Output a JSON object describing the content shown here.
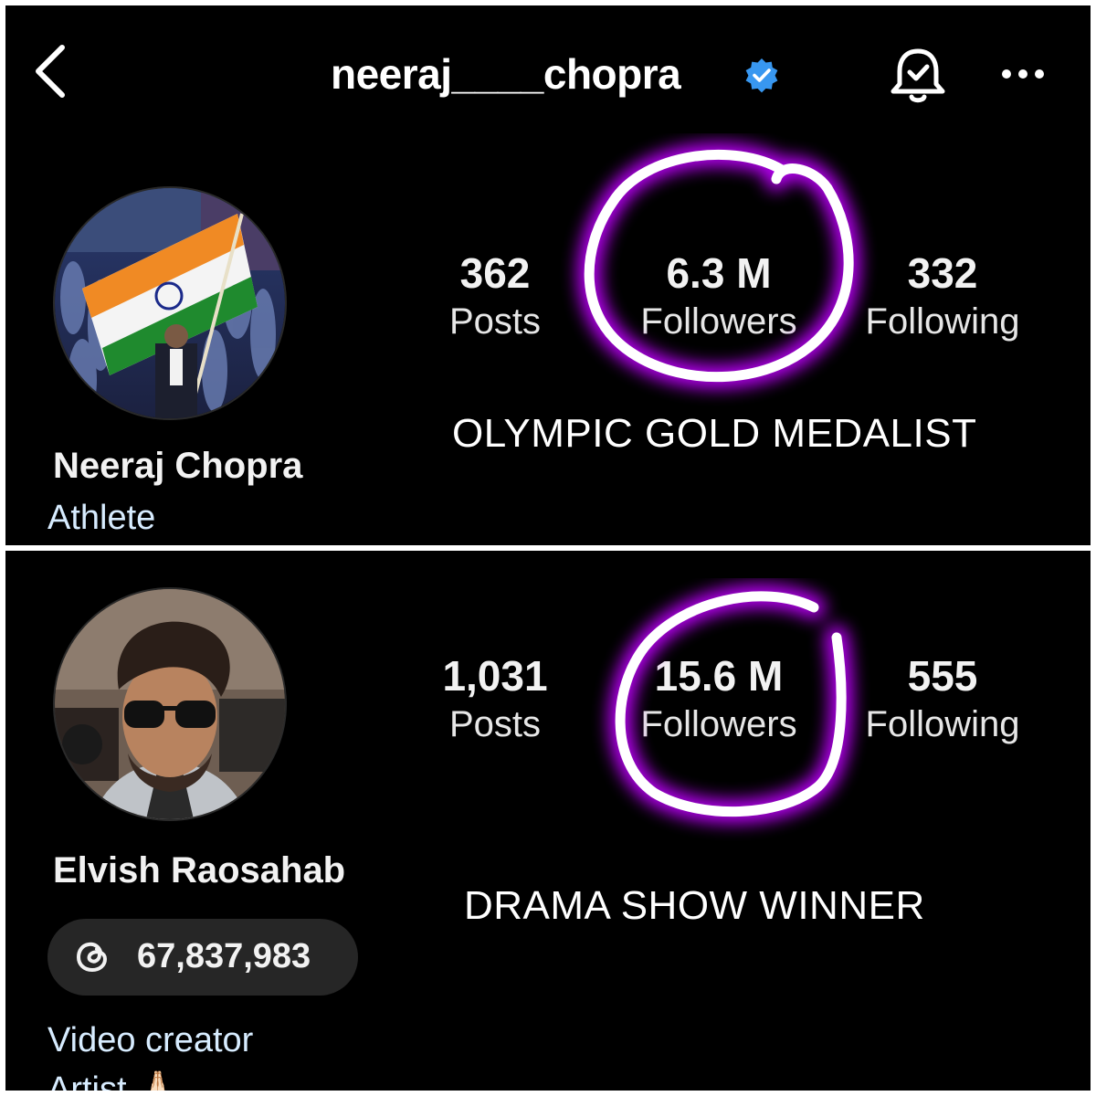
{
  "top": {
    "header": {
      "username": "neeraj____chopra",
      "verified": true,
      "icons": [
        "back-arrow-icon",
        "verified-badge-icon",
        "bell-check-icon",
        "more-options-icon"
      ]
    },
    "stats": [
      {
        "value": "362",
        "label": "Posts"
      },
      {
        "value": "6.3 M",
        "label": "Followers"
      },
      {
        "value": "332",
        "label": "Following"
      }
    ],
    "profile": {
      "name": "Neeraj Chopra",
      "category": "Athlete"
    },
    "caption": "OLYMPIC GOLD MEDALIST"
  },
  "bottom": {
    "stats": [
      {
        "value": "1,031",
        "label": "Posts"
      },
      {
        "value": "15.6 M",
        "label": "Followers"
      },
      {
        "value": "555",
        "label": "Following"
      }
    ],
    "profile": {
      "name": "Elvish Raosahab",
      "threads_count": "67,837,983",
      "category": "Video creator",
      "category2": "Artist 🙏🏻"
    },
    "caption": "DRAMA SHOW WINNER"
  },
  "colors": {
    "background": "#000000",
    "highlight_circle": "#ffffff",
    "highlight_glow": "#c000ff",
    "verified": "#3897f0",
    "category_text": "#d7ecff"
  }
}
